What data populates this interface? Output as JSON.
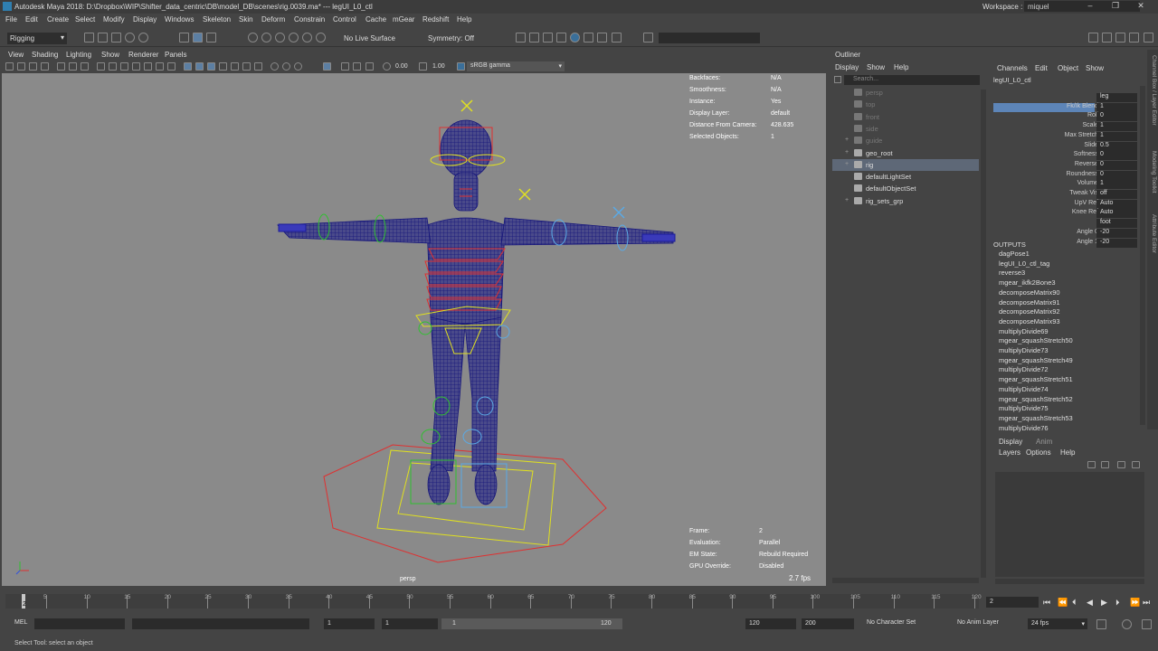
{
  "title": "Autodesk Maya 2018: D:\\Dropbox\\WIP\\Shifter_data_centric\\DB\\model_DB\\scenes\\rig.0039.ma*   ---   legUI_L0_ctl",
  "workspace_label": "Workspace :",
  "workspace_value": "miquel",
  "menu": [
    "File",
    "Edit",
    "Create",
    "Select",
    "Modify",
    "Display",
    "Windows",
    "Skeleton",
    "Skin",
    "Deform",
    "Constrain",
    "Control",
    "Cache",
    "mGear",
    "Redshift",
    "Help"
  ],
  "shelf": {
    "mode": "Rigging",
    "live_surface": "No Live Surface",
    "symmetry": "Symmetry: Off"
  },
  "viewport_menu": [
    "View",
    "Shading",
    "Lighting",
    "Show",
    "Renderer",
    "Panels"
  ],
  "viewport_toolbar": {
    "value_a": "0.00",
    "value_b": "1.00",
    "color_space": "sRGB gamma"
  },
  "hud_top": [
    {
      "label": "Backfaces:",
      "value": "N/A"
    },
    {
      "label": "Smoothness:",
      "value": "N/A"
    },
    {
      "label": "Instance:",
      "value": "Yes"
    },
    {
      "label": "Display Layer:",
      "value": "default"
    },
    {
      "label": "Distance From Camera:",
      "value": "428.635"
    },
    {
      "label": "Selected Objects:",
      "value": "1"
    }
  ],
  "hud_bottom": [
    {
      "label": "Frame:",
      "value": "2"
    },
    {
      "label": "Evaluation:",
      "value": "Parallel"
    },
    {
      "label": "EM State:",
      "value": "Rebuild Required"
    },
    {
      "label": "GPU Override:",
      "value": "Disabled"
    }
  ],
  "fps": "2.7 fps",
  "camera": "persp",
  "outliner": {
    "title": "Outliner",
    "menu": [
      "Display",
      "Show",
      "Help"
    ],
    "search_placeholder": "Search...",
    "items": [
      {
        "label": "persp",
        "dim": true,
        "expand": ""
      },
      {
        "label": "top",
        "dim": true,
        "expand": ""
      },
      {
        "label": "front",
        "dim": true,
        "expand": ""
      },
      {
        "label": "side",
        "dim": true,
        "expand": ""
      },
      {
        "label": "guide",
        "dim": true,
        "expand": "+"
      },
      {
        "label": "geo_root",
        "dim": false,
        "expand": "+"
      },
      {
        "label": "rig",
        "dim": false,
        "expand": "+",
        "selected": true
      },
      {
        "label": "defaultLightSet",
        "dim": false,
        "expand": ""
      },
      {
        "label": "defaultObjectSet",
        "dim": false,
        "expand": ""
      },
      {
        "label": "rig_sets_grp",
        "dim": false,
        "expand": "+"
      }
    ]
  },
  "channel_box": {
    "menu": [
      "Channels",
      "Edit",
      "Object",
      "Show"
    ],
    "object": "legUI_L0_ctl",
    "attrs": [
      {
        "name": "",
        "value": "leg"
      },
      {
        "name": "Fk/Ik Blend",
        "value": "1",
        "selected": true
      },
      {
        "name": "Roll",
        "value": "0"
      },
      {
        "name": "Scale",
        "value": "1"
      },
      {
        "name": "Max Stretch",
        "value": "1"
      },
      {
        "name": "Slide",
        "value": "0.5"
      },
      {
        "name": "Softness",
        "value": "0"
      },
      {
        "name": "Reverse",
        "value": "0"
      },
      {
        "name": "Roundness",
        "value": "0"
      },
      {
        "name": "Volume",
        "value": "1"
      },
      {
        "name": "Tweak Vis",
        "value": "off"
      },
      {
        "name": "UpV Ref",
        "value": "Auto"
      },
      {
        "name": "Knee Ref",
        "value": "Auto"
      },
      {
        "name": "",
        "value": "foot"
      },
      {
        "name": "Angle 0",
        "value": "-20"
      },
      {
        "name": "Angle 1",
        "value": "-20"
      }
    ],
    "outputs_title": "OUTPUTS",
    "outputs": [
      "dagPose1",
      "legUI_L0_ctl_tag",
      "reverse3",
      "mgear_ikfk2Bone3",
      "decomposeMatrix90",
      "decomposeMatrix91",
      "decomposeMatrix92",
      "decomposeMatrix93",
      "multiplyDivide69",
      "mgear_squashStretch50",
      "multiplyDivide73",
      "mgear_squashStretch49",
      "multiplyDivide72",
      "mgear_squashStretch51",
      "multiplyDivide74",
      "mgear_squashStretch52",
      "multiplyDivide75",
      "mgear_squashStretch53",
      "multiplyDivide76"
    ]
  },
  "side_tabs": [
    "Channel Box / Layer Editor",
    "Modeling Toolkit",
    "Attribute Editor"
  ],
  "layer_editor": {
    "tabs": [
      "Display",
      "Anim"
    ],
    "menu": [
      "Layers",
      "Options",
      "Help"
    ]
  },
  "timeline": {
    "ticks": [
      "5",
      "10",
      "15",
      "20",
      "25",
      "30",
      "35",
      "40",
      "45",
      "50",
      "55",
      "60",
      "65",
      "70",
      "75",
      "80",
      "85",
      "90",
      "95",
      "100",
      "105",
      "110",
      "115",
      "120"
    ],
    "current": "2",
    "frame_field": "2"
  },
  "range": {
    "start": "1",
    "range_start": "1",
    "slider_start": "1",
    "slider_end": "120",
    "range_end": "120",
    "end": "200",
    "character_set": "No Character Set",
    "anim_layer": "No Anim Layer",
    "fps": "24 fps"
  },
  "command_line": {
    "mode": "MEL"
  },
  "status": "Select Tool: select an object",
  "colors": {
    "viewport_bg": "#8a8a8a",
    "wire": "#1a1a9a",
    "selection": "#5e6877"
  }
}
